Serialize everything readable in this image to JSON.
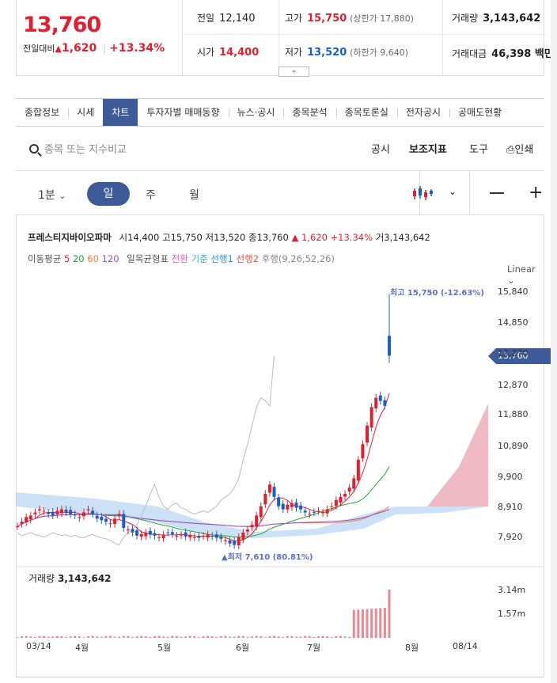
{
  "quote": {
    "price": "13,760",
    "change_label": "전일대비",
    "change_arrow": "▲",
    "change": "1,620",
    "change_pct": "+13.34%",
    "prev_close_label": "전일",
    "prev_close": "12,140",
    "high_label": "고가",
    "high": "15,750",
    "upper_limit": "(상한가 17,880)",
    "volume_label": "거래량",
    "volume": "3,143,642",
    "open_label": "시가",
    "open": "14,400",
    "low_label": "저가",
    "low": "13,520",
    "lower_limit": "(하한가 9,640)",
    "amount_label": "거래대금",
    "amount": "46,398 백만"
  },
  "tabs": [
    "종합정보",
    "시세",
    "차트",
    "투자자별 매매동향",
    "뉴스·공시",
    "종목분석",
    "종목토론실",
    "전자공시",
    "공매도현황"
  ],
  "active_tab": "차트",
  "toolbar": {
    "search_placeholder": "종목 또는 지수비교",
    "notice": "공시",
    "indicator": "보조지표",
    "tools": "도구",
    "print": "인쇄"
  },
  "periods": {
    "minute": "1분",
    "day": "일",
    "week": "주",
    "month": "월"
  },
  "chart_head": {
    "name": "프레스티지바이오파마",
    "open_l": "시",
    "open": "14,400",
    "high_l": "고",
    "high": "15,750",
    "low_l": "저",
    "low": "13,520",
    "close_l": "종",
    "close": "13,760",
    "chg": "▲ 1,620 +13.34%",
    "vol_l": "거",
    "vol": "3,143,642"
  },
  "indicators": {
    "ma_label": "이동평균",
    "ma5": "5",
    "ma20": "20",
    "ma60": "60",
    "ma120": "120",
    "ichimoku_label": "일목균형표",
    "conv": "전환",
    "base": "기준",
    "span1": "선행1",
    "span2": "선행2",
    "lag": "후행(9,26,52,26)"
  },
  "colors": {
    "up": "#e0202f",
    "down": "#1a5fc8",
    "accent": "#3d5a99"
  },
  "chart_data": {
    "type": "candlestick",
    "scale": "Linear",
    "y_ticks": [
      "15,840",
      "14,850",
      "13,870",
      "12,870",
      "11,880",
      "10,890",
      "9,900",
      "8,910",
      "7,920"
    ],
    "current_price": "13,760",
    "high_note": "최고 15,750 (-12.63%)",
    "low_note": "▲최저 7,610 (80.81%)",
    "x_labels": [
      "03/14",
      "4월",
      "5월",
      "6월",
      "7월",
      "8월",
      "08/14"
    ],
    "volume_label": "거래량",
    "volume_value": "3,143,642",
    "volume_ticks": [
      "3.14m",
      "1.57m"
    ]
  }
}
